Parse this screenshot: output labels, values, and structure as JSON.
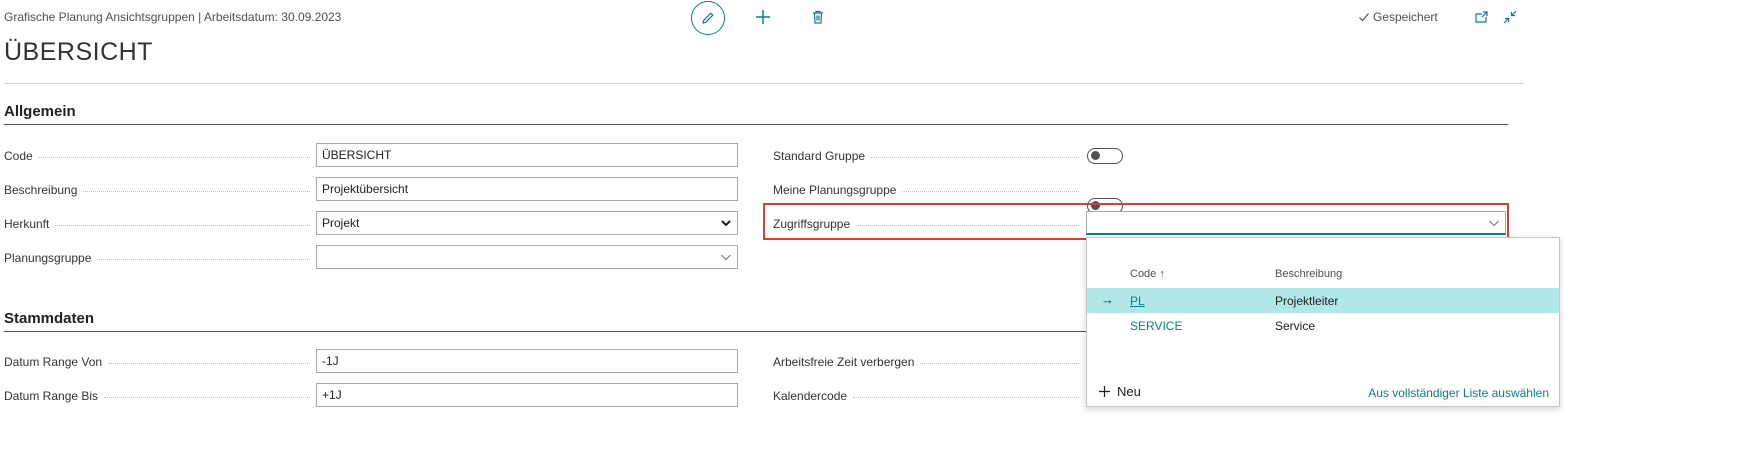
{
  "header": {
    "breadcrumb": "Grafische Planung Ansichtsgruppen | Arbeitsdatum: 30.09.2023",
    "title": "ÜBERSICHT",
    "saved_label": "Gespeichert"
  },
  "sections": {
    "general": "Allgemein",
    "master": "Stammdaten"
  },
  "fields": {
    "code": {
      "label": "Code",
      "value": "ÜBERSICHT"
    },
    "beschreibung": {
      "label": "Beschreibung",
      "value": "Projektübersicht"
    },
    "herkunft": {
      "label": "Herkunft",
      "value": "Projekt"
    },
    "planungsgruppe": {
      "label": "Planungsgruppe",
      "value": ""
    },
    "standard_gruppe": {
      "label": "Standard Gruppe",
      "on": false
    },
    "meine_planungsgruppe": {
      "label": "Meine Planungsgruppe",
      "on": false
    },
    "zugriffsgruppe": {
      "label": "Zugriffsgruppe",
      "value": ""
    },
    "datum_von": {
      "label": "Datum Range Von",
      "value": "-1J"
    },
    "datum_bis": {
      "label": "Datum Range Bis",
      "value": "+1J"
    },
    "arbeitsfreie_zeit": {
      "label": "Arbeitsfreie Zeit verbergen"
    },
    "kalendercode": {
      "label": "Kalendercode"
    }
  },
  "dropdown": {
    "col_code": "Code",
    "col_beschreibung": "Beschreibung",
    "rows": [
      {
        "code": "PL",
        "beschreibung": "Projektleiter"
      },
      {
        "code": "SERVICE",
        "beschreibung": "Service"
      }
    ],
    "new_label": "Neu",
    "full_list_label": "Aus vollständiger Liste auswählen"
  },
  "colors": {
    "accent": "#0e7d83",
    "highlight": "#e53935",
    "selected_row": "#b2e7ea"
  }
}
